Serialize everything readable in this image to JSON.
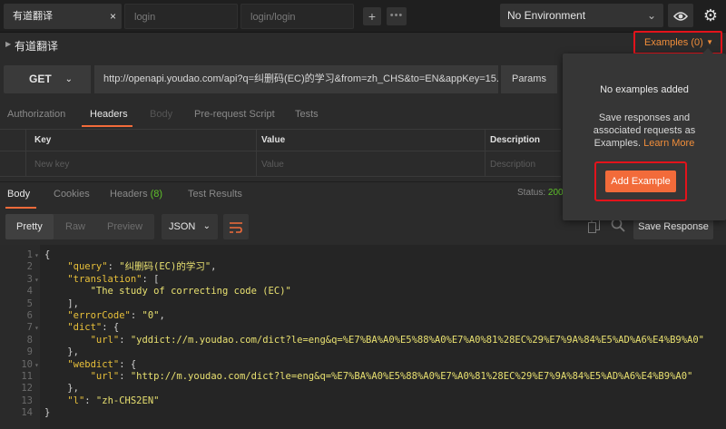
{
  "tabs": [
    {
      "label": "有道翻译",
      "close": "×"
    },
    {
      "label": "login"
    },
    {
      "label": "login/login"
    }
  ],
  "tab_add": "+",
  "tab_more": "•••",
  "environment": {
    "selected": "No Environment",
    "chevron": "⌄"
  },
  "request": {
    "name": "有道翻译",
    "method": "GET",
    "url": "http://openapi.youdao.com/api?q=纠删码(EC)的学习&from=zh_CHS&to=EN&appKey=15...",
    "params_label": "Params"
  },
  "examples_button": {
    "label": "Examples (0)",
    "chevron": "▼"
  },
  "request_tabs": [
    "Authorization",
    "Headers",
    "Body",
    "Pre-request Script",
    "Tests"
  ],
  "headers_table": {
    "columns": [
      "Key",
      "Value",
      "Description"
    ],
    "placeholders": [
      "New key",
      "Value",
      "Description"
    ]
  },
  "response_tabs": {
    "body": "Body",
    "cookies": "Cookies",
    "headers": "Headers",
    "headers_count": "(8)",
    "tests": "Test Results"
  },
  "status": {
    "label": "Status:",
    "value": "200"
  },
  "response_toolbar": {
    "pretty": "Pretty",
    "raw": "Raw",
    "preview": "Preview",
    "format": "JSON",
    "save_response": "Save Response"
  },
  "popover": {
    "title": "No examples added",
    "desc": "Save responses and associated requests as Examples.",
    "link": "Learn More",
    "add_button": "Add Example"
  },
  "code_lines": [
    {
      "n": "1",
      "fold": "▾",
      "text": "{"
    },
    {
      "n": "2",
      "fold": "",
      "key": "\"query\"",
      "rest": ": ",
      "val": "\"纠删码(EC)的学习\"",
      "end": ",",
      "indent": "    "
    },
    {
      "n": "3",
      "fold": "▾",
      "key": "\"translation\"",
      "rest": ": [",
      "val": "",
      "end": "",
      "indent": "    "
    },
    {
      "n": "4",
      "fold": "",
      "key": "",
      "rest": "",
      "val": "\"The study of correcting code (EC)\"",
      "end": "",
      "indent": "        "
    },
    {
      "n": "5",
      "fold": "",
      "text": "    ],"
    },
    {
      "n": "6",
      "fold": "",
      "key": "\"errorCode\"",
      "rest": ": ",
      "val": "\"0\"",
      "end": ",",
      "indent": "    "
    },
    {
      "n": "7",
      "fold": "▾",
      "key": "\"dict\"",
      "rest": ": {",
      "val": "",
      "end": "",
      "indent": "    "
    },
    {
      "n": "8",
      "fold": "",
      "key": "\"url\"",
      "rest": ": ",
      "val": "\"yddict://m.youdao.com/dict?le=eng&q=%E7%BA%A0%E5%88%A0%E7%A0%81%28EC%29%E7%9A%84%E5%AD%A6%E4%B9%A0\"",
      "end": "",
      "indent": "        "
    },
    {
      "n": "9",
      "fold": "",
      "text": "    },"
    },
    {
      "n": "10",
      "fold": "▾",
      "key": "\"webdict\"",
      "rest": ": {",
      "val": "",
      "end": "",
      "indent": "    "
    },
    {
      "n": "11",
      "fold": "",
      "key": "\"url\"",
      "rest": ": ",
      "val": "\"http://m.youdao.com/dict?le=eng&q=%E7%BA%A0%E5%88%A0%E7%A0%81%28EC%29%E7%9A%84%E5%AD%A6%E4%B9%A0\"",
      "end": "",
      "indent": "        "
    },
    {
      "n": "12",
      "fold": "",
      "text": "    },"
    },
    {
      "n": "13",
      "fold": "",
      "key": "\"l\"",
      "rest": ": ",
      "val": "\"zh-CHS2EN\"",
      "end": "",
      "indent": "    "
    },
    {
      "n": "14",
      "fold": "",
      "text": "}"
    }
  ],
  "colors": {
    "accent": "#f26b3a",
    "highlight": "#e3131b",
    "success": "#5fc12a"
  }
}
